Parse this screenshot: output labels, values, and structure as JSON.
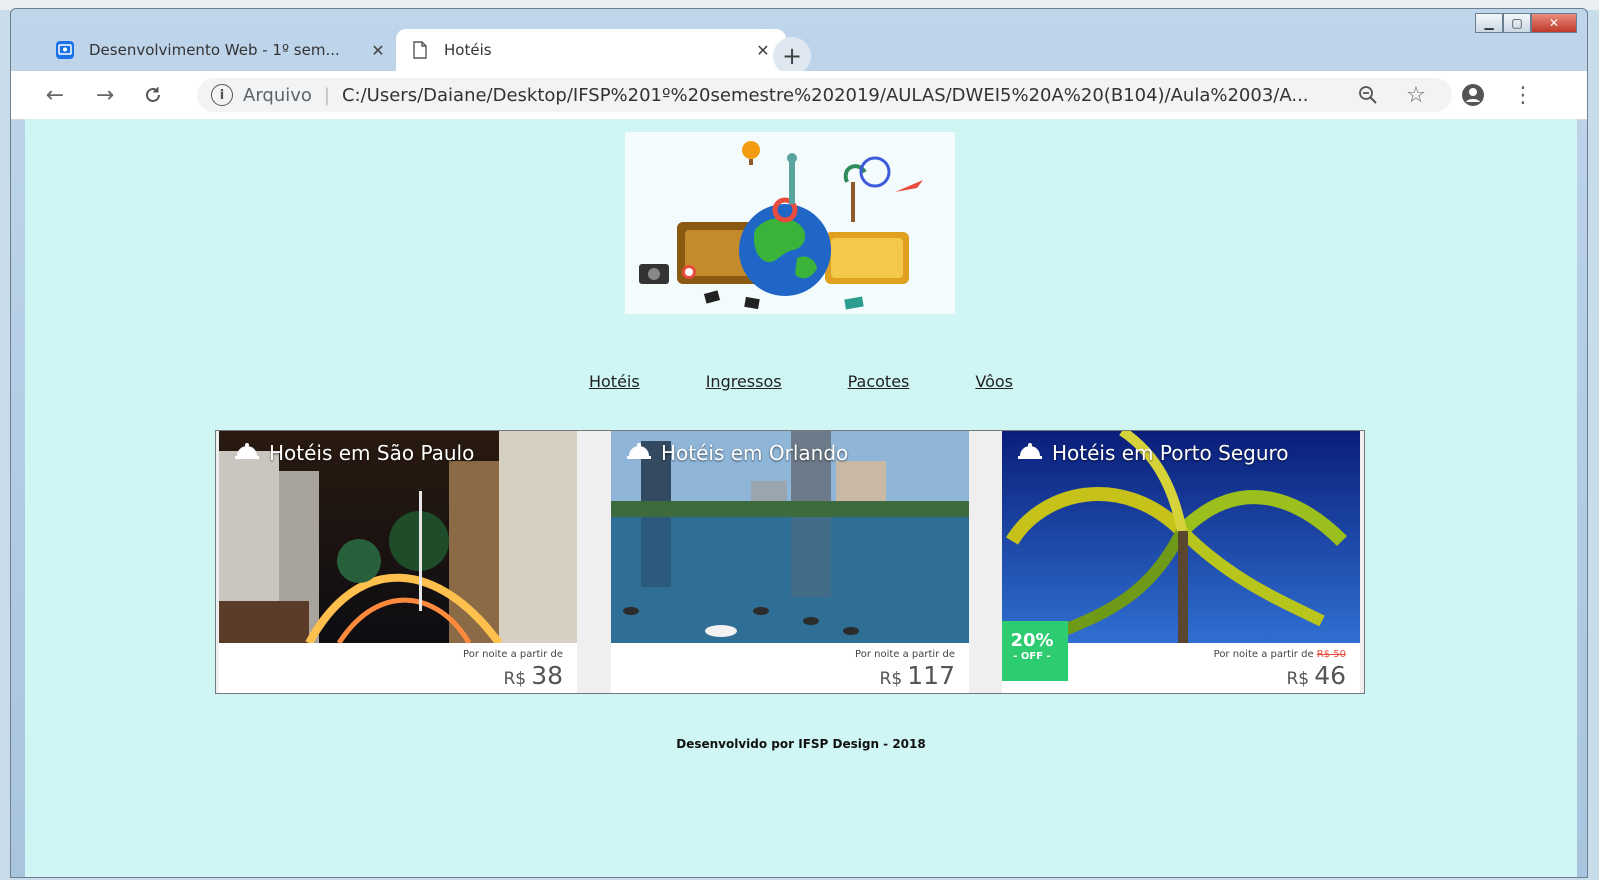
{
  "browser": {
    "tabs": [
      {
        "title": "Desenvolvimento Web - 1º sem...",
        "active": false,
        "icon": "classroom-icon"
      },
      {
        "title": "Hotéis",
        "active": true,
        "icon": "document-icon"
      }
    ],
    "new_tab_icon": "+",
    "address": {
      "scheme_label": "Arquivo",
      "url": "C:/Users/Daiane/Desktop/IFSP%201º%20semestre%202019/AULAS/DWEI5%20A%20(B104)/Aula%2003/A..."
    },
    "accent": "#1a73e8"
  },
  "page": {
    "background": "#cff5f5",
    "menu": [
      "Hotéis",
      "Ingressos",
      "Pacotes",
      "Vôos"
    ],
    "cards": [
      {
        "title": "Hotéis em São Paulo",
        "from_label": "Por noite a partir de",
        "old_price": "",
        "currency": "R$",
        "price": "38"
      },
      {
        "title": "Hotéis em Orlando",
        "from_label": "Por noite a partir de",
        "old_price": "",
        "currency": "R$",
        "price": "117"
      },
      {
        "title": "Hotéis em Porto Seguro",
        "from_label": "Por noite a partir de",
        "old_price": "R$ 50",
        "currency": "R$",
        "price": "46",
        "badge_pct": "20%",
        "badge_off": "- OFF -"
      }
    ],
    "footer": "Desenvolvido por IFSP Design - 2018"
  }
}
